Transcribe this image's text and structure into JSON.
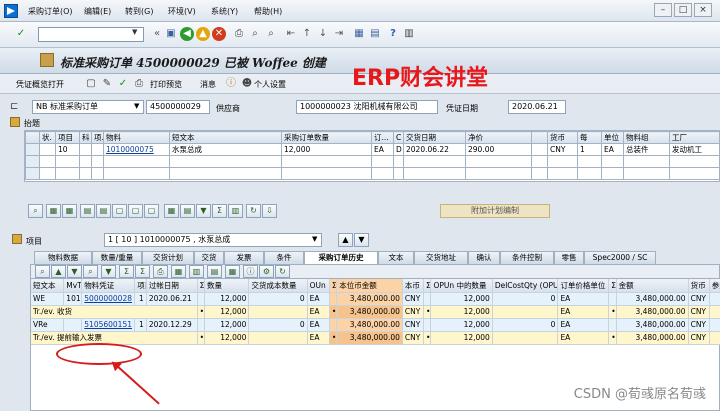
{
  "menubar": {
    "items": [
      "采购订单(O)",
      "编辑(E)",
      "转到(G)",
      "环境(V)",
      "系统(Y)",
      "帮助(H)"
    ]
  },
  "title": "标准采购订单 4500000029 已被 Woffee 创建",
  "watermark": "ERP财会讲堂",
  "toolbar2": {
    "overview_label": "凭证概览打开",
    "print_preview_label": "打印预览",
    "messages_label": "消息",
    "personal_settings_label": "个人设置"
  },
  "header": {
    "doc_type": "NB 标准采购订单",
    "po_number": "4500000029",
    "vendor_label": "供应商",
    "vendor_value": "1000000023 沈阳机械有限公司",
    "doc_date_label": "凭证日期",
    "doc_date_value": "2020.06.21"
  },
  "section_header_label": "抬题",
  "items_table": {
    "columns": [
      "状.",
      "项目",
      "科",
      "项.",
      "物料",
      "短文本",
      "采购订单数量",
      "订...",
      "C",
      "交货日期",
      "净价",
      "",
      "货币",
      "每",
      "单位",
      "物料组",
      "工厂"
    ],
    "row": [
      "10",
      "1010000075",
      "水泵总成",
      "12,000",
      "EA",
      "D",
      "2020.06.22",
      "290.00",
      "CNY",
      "1",
      "EA",
      "总装件",
      "发动机工"
    ]
  },
  "plan_button_label": "附加计划编制",
  "item_selector": {
    "label": "项目",
    "value": "1 [ 10 ] 1010000075 , 水泵总成"
  },
  "tabs": [
    "物料数据",
    "数量/重量",
    "交货计划",
    "交货",
    "发票",
    "条件",
    "采购订单历史",
    "文本",
    "交货地址",
    "确认",
    "条件控制",
    "零售",
    "Spec2000 / SC"
  ],
  "history_table": {
    "columns": [
      "短文本",
      "MvT",
      "物料凭证",
      "项目",
      "过帐日期",
      "Σ",
      "数量",
      "交货成本数量",
      "OUn",
      "Σ",
      "本位币金额",
      "本币",
      "Σ",
      "OPUn 中的数量",
      "DelCostQty (OPUn)",
      "订单价格单位",
      "Σ",
      "金额",
      "货币",
      "参照"
    ],
    "rows": [
      {
        "type": "data",
        "cells": [
          "WE",
          "101",
          "5000000028",
          "1",
          "2020.06.21",
          "",
          "12,000",
          "0",
          "EA",
          "",
          "3,480,000.00",
          "CNY",
          "",
          "12,000",
          "0",
          "EA",
          "",
          "3,480,000.00",
          "CNY",
          ""
        ]
      },
      {
        "type": "sub",
        "cells": [
          "Tr./ev. 收货",
          "",
          "",
          "",
          "",
          "•",
          "12,000",
          "",
          "EA",
          "•",
          "3,480,000.00",
          "CNY",
          "•",
          "12,000",
          "",
          "EA",
          "•",
          "3,480,000.00",
          "CNY",
          ""
        ]
      },
      {
        "type": "data",
        "cells": [
          "VRe",
          "",
          "5105600151",
          "1",
          "2020.12.29",
          "",
          "12,000",
          "0",
          "EA",
          "",
          "3,480,000.00",
          "CNY",
          "",
          "12,000",
          "0",
          "EA",
          "",
          "3,480,000.00",
          "CNY",
          ""
        ]
      },
      {
        "type": "sub",
        "cells": [
          "Tr./ev. 提前输入发票",
          "",
          "",
          "",
          "",
          "•",
          "12,000",
          "",
          "EA",
          "•",
          "3,480,000.00",
          "CNY",
          "•",
          "12,000",
          "",
          "EA",
          "•",
          "3,480,000.00",
          "CNY",
          ""
        ]
      }
    ]
  },
  "footer_credit": "CSDN @荀彧原名荀彧",
  "colors": {
    "watermark": "#e8171b",
    "annotation": "#d61b1b",
    "highlight_column": "#fbd3a6"
  }
}
